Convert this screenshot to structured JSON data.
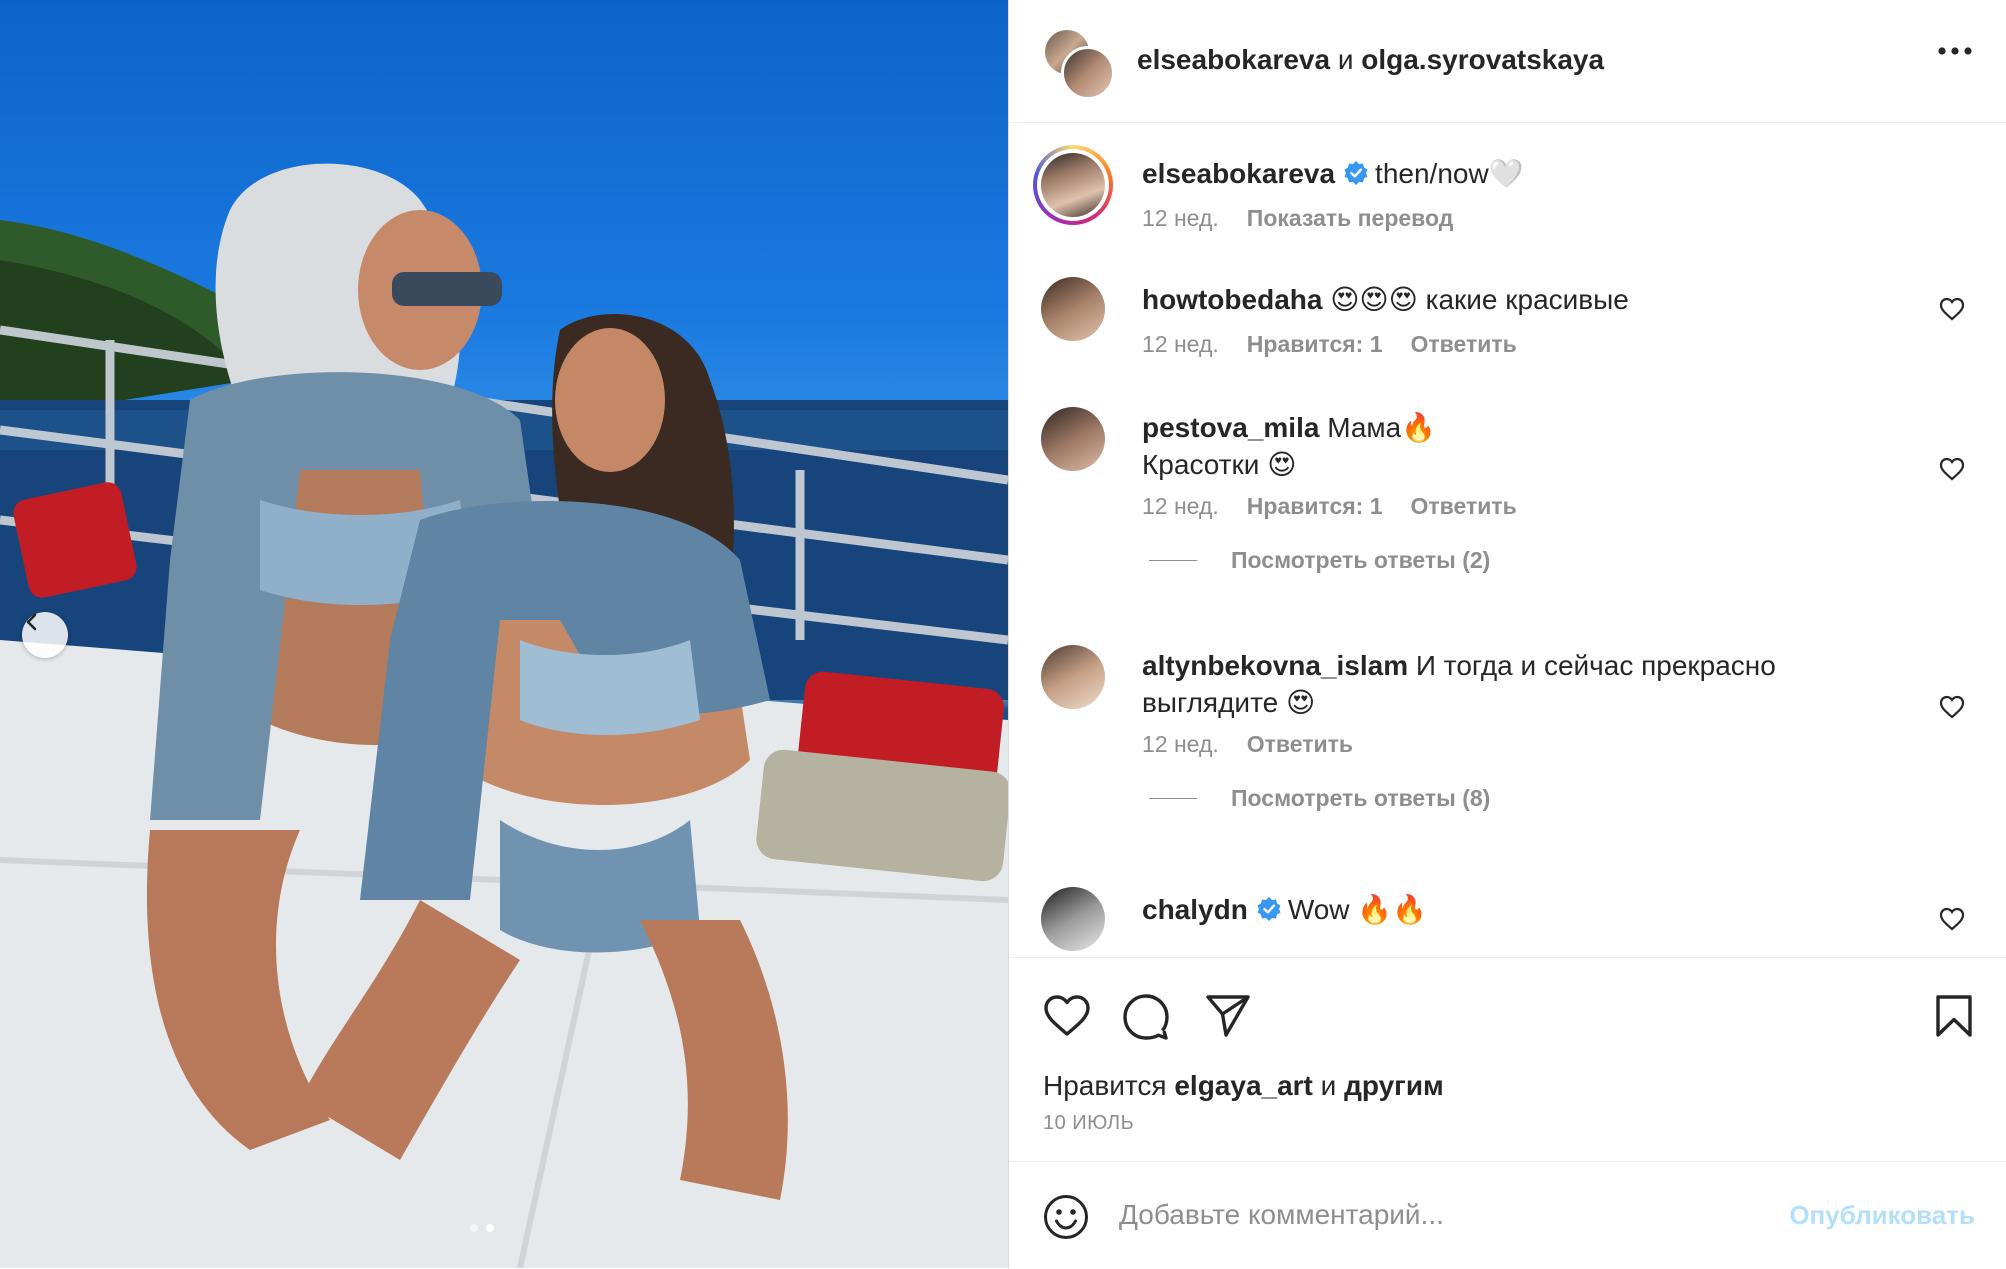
{
  "post": {
    "header": {
      "user1": "elseabokareva",
      "conjunction": "и",
      "user2": "olga.syrovatskaya"
    },
    "caption": {
      "username": "elseabokareva",
      "text": "then/now🤍",
      "age": "12 нед.",
      "translate": "Показать перевод"
    },
    "comments": [
      {
        "username": "howtobedaha",
        "text": "😍😍😍 какие красивые",
        "age": "12 нед.",
        "likes": "Нравится: 1",
        "reply": "Ответить"
      },
      {
        "username": "pestova_mila",
        "text": "Мама🔥",
        "text2": "Красотки 😍",
        "age": "12 нед.",
        "likes": "Нравится: 1",
        "reply": "Ответить",
        "view_replies": "Посмотреть ответы (2)"
      },
      {
        "username": "altynbekovna_islam",
        "text": "И тогда и сейчас прекрасно",
        "text2": "выглядите 😍",
        "age": "12 нед.",
        "reply": "Ответить",
        "view_replies": "Посмотреть ответы (8)"
      },
      {
        "username": "chalydn",
        "text": "Wow 🔥🔥"
      }
    ],
    "likes": {
      "prefix": "Нравится",
      "user": "elgaya_art",
      "middle": "и",
      "others": "другим"
    },
    "date": "10 ИЮЛЬ",
    "composer": {
      "placeholder": "Добавьте комментарий...",
      "publish": "Опубликовать"
    },
    "colors": {
      "verified": "#3897f0",
      "text": "#262626",
      "muted": "#8e8e8e",
      "publish_disabled": "#b3dffc"
    },
    "icons": [
      "more-icon",
      "verified-icon",
      "heart-icon",
      "comment-icon",
      "share-icon",
      "bookmark-icon",
      "emoji-icon",
      "chevron-left-icon"
    ]
  }
}
